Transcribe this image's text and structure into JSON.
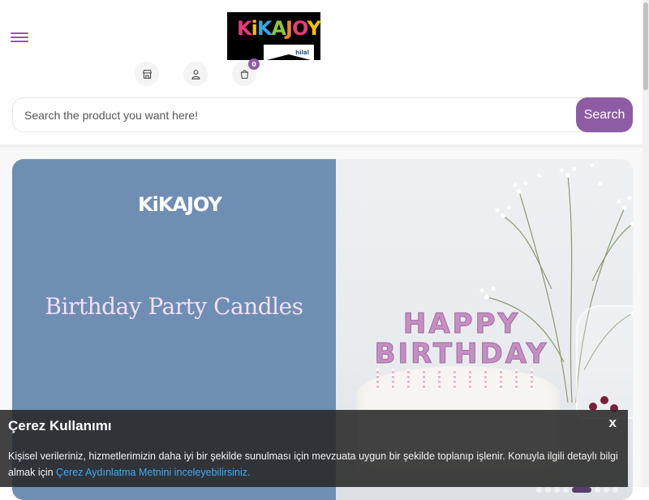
{
  "brand": {
    "logo_letters": [
      "K",
      "i",
      "K",
      "A",
      "J",
      "O",
      "Y"
    ],
    "logo_sub": "hilal"
  },
  "header": {
    "menu_icon": "hamburger-menu-icon",
    "icons": [
      {
        "name": "store-icon"
      },
      {
        "name": "user-icon"
      },
      {
        "name": "cart-icon",
        "badge": "0"
      }
    ]
  },
  "search": {
    "placeholder": "Search the product you want here!",
    "value": "",
    "button_label": "Search"
  },
  "banner": {
    "logo_text": "KiKAJOY",
    "title": "Birthday Party Candles",
    "candle_line_1": "HAPPY",
    "candle_line_2": "BIRTHDAY",
    "slide_count": 9,
    "active_slide": 6
  },
  "cookie": {
    "title": "Çerez Kullanımı",
    "close_label": "x",
    "text": "Kişisel verileriniz, hizmetlerimizin daha iyi bir şekilde sunulması için mevzuata uygun bir şekilde toplanıp işlenir. Konuyla ilgili detaylı bilgi almak için ",
    "link_text": "Çerez Aydınlatma Metnini inceleyebilirsiniz."
  },
  "colors": {
    "accent": "#8e5ca4",
    "banner_blue": "#6f8eb4",
    "link": "#3fa9f5"
  }
}
